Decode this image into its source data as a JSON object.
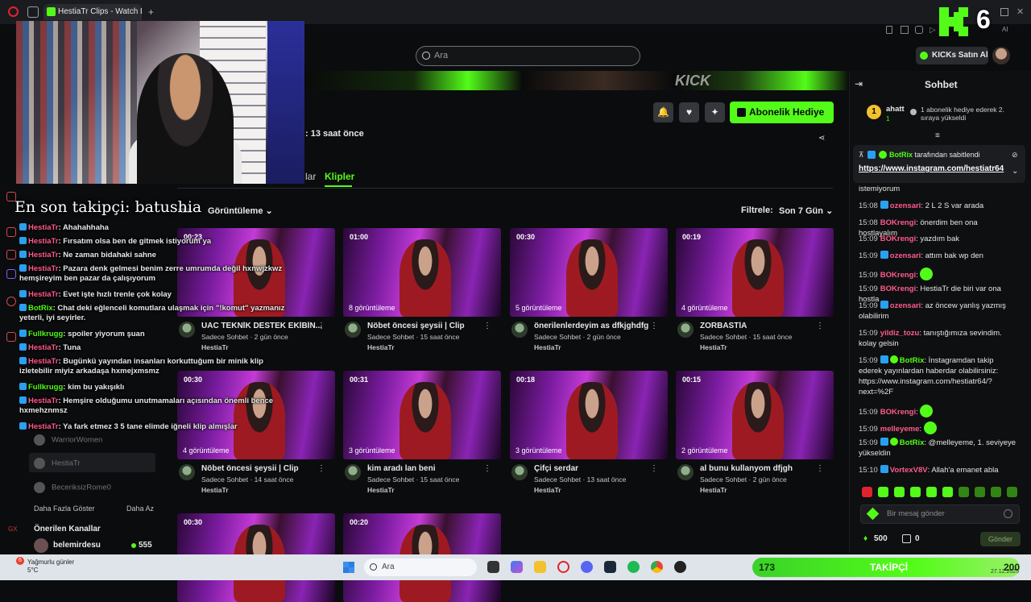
{
  "browser": {
    "tab_title": "HestiaTr Clips - Watch Live",
    "new_tab": "+",
    "ai_label": "AI"
  },
  "header": {
    "search_placeholder": "Ara",
    "kicks_button": "KICKs Satın Al",
    "kick_badge": "6",
    "banner_text": "KICK"
  },
  "channel": {
    "gift_button": "Abonelik Hediye Et",
    "time_ago": ": 13 saat önce",
    "tab_fragment": "lar",
    "active_tab": "Klipler",
    "sort_fragment": "rala",
    "sort_value": "Görüntüleme",
    "filter_label": "Filtrele:",
    "filter_value": "Son 7 Gün"
  },
  "clips": [
    {
      "duration": "00:23",
      "views": "",
      "title": "UAC TEKNİK DESTEK EKİBİN...",
      "sub": "Sadece Sohbet · 2 gün önce",
      "channel": "HestiaTr"
    },
    {
      "duration": "01:00",
      "views": "8 görüntüleme",
      "title": "Nöbet öncesi şeysii | Clip",
      "sub": "Sadece Sohbet · 15 saat önce",
      "channel": "HestiaTr"
    },
    {
      "duration": "00:30",
      "views": "5 görüntüleme",
      "title": "önerilenlerdeyim as dfkjghdfg",
      "sub": "Sadece Sohbet · 2 gün önce",
      "channel": "HestiaTr"
    },
    {
      "duration": "00:19",
      "views": "4 görüntüleme",
      "title": "ZORBASTİA",
      "sub": "Sadece Sohbet · 15 saat önce",
      "channel": "HestiaTr"
    },
    {
      "duration": "00:30",
      "views": "4 görüntüleme",
      "title": "Nöbet öncesi şeysii | Clip",
      "sub": "Sadece Sohbet · 14 saat önce",
      "channel": "HestiaTr"
    },
    {
      "duration": "00:31",
      "views": "3 görüntüleme",
      "title": "kim aradı lan beni",
      "sub": "Sadece Sohbet · 15 saat önce",
      "channel": "HestiaTr"
    },
    {
      "duration": "00:18",
      "views": "3 görüntüleme",
      "title": "Çifçi serdar",
      "sub": "Sadece Sohbet · 13 saat önce",
      "channel": "HestiaTr"
    },
    {
      "duration": "00:15",
      "views": "2 görüntüleme",
      "title": "al bunu kullanyom dfjgh",
      "sub": "Sadece Sohbet · 2 gün önce",
      "channel": "HestiaTr"
    },
    {
      "duration": "00:30",
      "views": "",
      "title": "",
      "sub": "",
      "channel": ""
    },
    {
      "duration": "00:20",
      "views": "",
      "title": "",
      "sub": "",
      "channel": ""
    }
  ],
  "overlay": {
    "latest_follower": "En son takipçi: batushia",
    "messages": [
      {
        "user": "HestiaTr",
        "text": ": Ahahahhaha"
      },
      {
        "user": "HestiaTr",
        "text": ": Fırsatım olsa ben de gitmek istiyorum ya"
      },
      {
        "user": "HestiaTr",
        "text": ": Ne zaman bidahaki sahne"
      },
      {
        "user": "HestiaTr",
        "text": ": Pazara denk gelmesi benim zerre umrumda değil hxnwjzkwz hemşireyim ben pazar da çalışıyorum"
      },
      {
        "user": "HestiaTr",
        "text": ": Evet işte hızlı trenle çok kolay"
      },
      {
        "user": "BotRix",
        "text": ": Chat deki eğlenceli komutlara ulaşmak için \"!komut\" yazmanız yeterli, iyi seyirler."
      },
      {
        "user": "Fullkrugg",
        "text": ": spoiler yiyorum şuan"
      },
      {
        "user": "HestiaTr",
        "text": ": Tuna"
      },
      {
        "user": "HestiaTr",
        "text": ": Bugünkü yayından insanları korkuttuğum bir minik klip izletebilir miyiz arkadaşa hxmejxmsmz"
      },
      {
        "user": "Fullkrugg",
        "text": ": kim bu yakışıklı"
      },
      {
        "user": "HestiaTr",
        "text": ": Hemşire olduğumu unutmamaları açısından önemli bence hxmehznmsz"
      },
      {
        "user": "HestiaTr",
        "text": ": Ya fark etmez 3 5 tane elimde iğneli klip almışlar"
      }
    ]
  },
  "sidebar": {
    "users": [
      "WarriorWomen",
      "HestiaTr",
      "BeceriksizRome0"
    ],
    "show_more": "Daha Fazla Göster",
    "show_less": "Daha Az",
    "recommended_title": "Önerilen Kanallar",
    "recommended": [
      {
        "name": "belemirdesu",
        "viewers": "555"
      }
    ]
  },
  "chat": {
    "title": "Sohbet",
    "gifter": {
      "rank": "1",
      "name": "ahatt",
      "count": "1",
      "message": "1 abonelik hediye ederek 2. sıraya yükseldi"
    },
    "pinned_by_user": "BotRix",
    "pinned_by_text": "tarafından sabitlendi",
    "pinned_link": "https://www.instagram.com/hestiatr64",
    "messages": [
      {
        "time": "",
        "user": "",
        "color": "#e5e5e5",
        "text": "istemiyorum"
      },
      {
        "time": "15:08",
        "user": "ozensari",
        "color": "#ff5b8b",
        "text": ": 2 L 2 S var arada"
      },
      {
        "time": "15:08",
        "user": "BOKrengi",
        "color": "#ff5b8b",
        "text": ": önerdim ben ona hostlayalım"
      },
      {
        "time": "15:09",
        "user": "BOKrengi",
        "color": "#ff5b8b",
        "text": ": yazdım bak"
      },
      {
        "time": "15:09",
        "user": "ozensari",
        "color": "#ff5b8b",
        "text": ": attım bak wp den"
      },
      {
        "time": "15:09",
        "user": "BOKrengi",
        "color": "#ff5b8b",
        "text": ":"
      },
      {
        "time": "15:09",
        "user": "BOKrengi",
        "color": "#ff5b8b",
        "text": ": HestiaTr die biri var ona hostla"
      },
      {
        "time": "15:09",
        "user": "ozensari",
        "color": "#ff5b8b",
        "text": ": az öncew yanlış yazmış olabilirim"
      },
      {
        "time": "15:09",
        "user": "yildiz_tozu",
        "color": "#ff5b8b",
        "text": ": tanıştığımıza sevindim. kolay gelsin"
      },
      {
        "time": "15:09",
        "user": "BotRix",
        "color": "#53fc18",
        "text": ": İnstagramdan takip ederek yayınlardan haberdar olabilirsiniz: https://www.instagram.com/hestiatr64/?next=%2F"
      },
      {
        "time": "15:09",
        "user": "BOKrengi",
        "color": "#ff5b8b",
        "text": ":"
      },
      {
        "time": "15:09",
        "user": "melleyeme",
        "color": "#ff5b8b",
        "text": ":"
      },
      {
        "time": "15:09",
        "user": "BotRix",
        "color": "#53fc18",
        "text": ": @melleyeme, 1. seviyeye yükseldin"
      },
      {
        "time": "15:10",
        "user": "VortexV8V",
        "color": "#ff5b8b",
        "text": ": Allah'a emanet abla"
      }
    ],
    "input_placeholder": "Bir mesaj gönder",
    "points": "500",
    "boxes": "0",
    "send_button": "Gönder"
  },
  "taskbar": {
    "weather_title": "Yağmurlu günler",
    "weather_temp": "5°C",
    "weather_badge": "6",
    "search": "Ara",
    "goal_current": "173",
    "goal_label": "TAKİPÇİ",
    "goal_target": "200",
    "date": "27.12.2025"
  },
  "colors": {
    "accent": "#53fc18",
    "background": "#0b0c0e",
    "username_pink": "#ff5b8b",
    "goal_bar": "#53fc18"
  }
}
